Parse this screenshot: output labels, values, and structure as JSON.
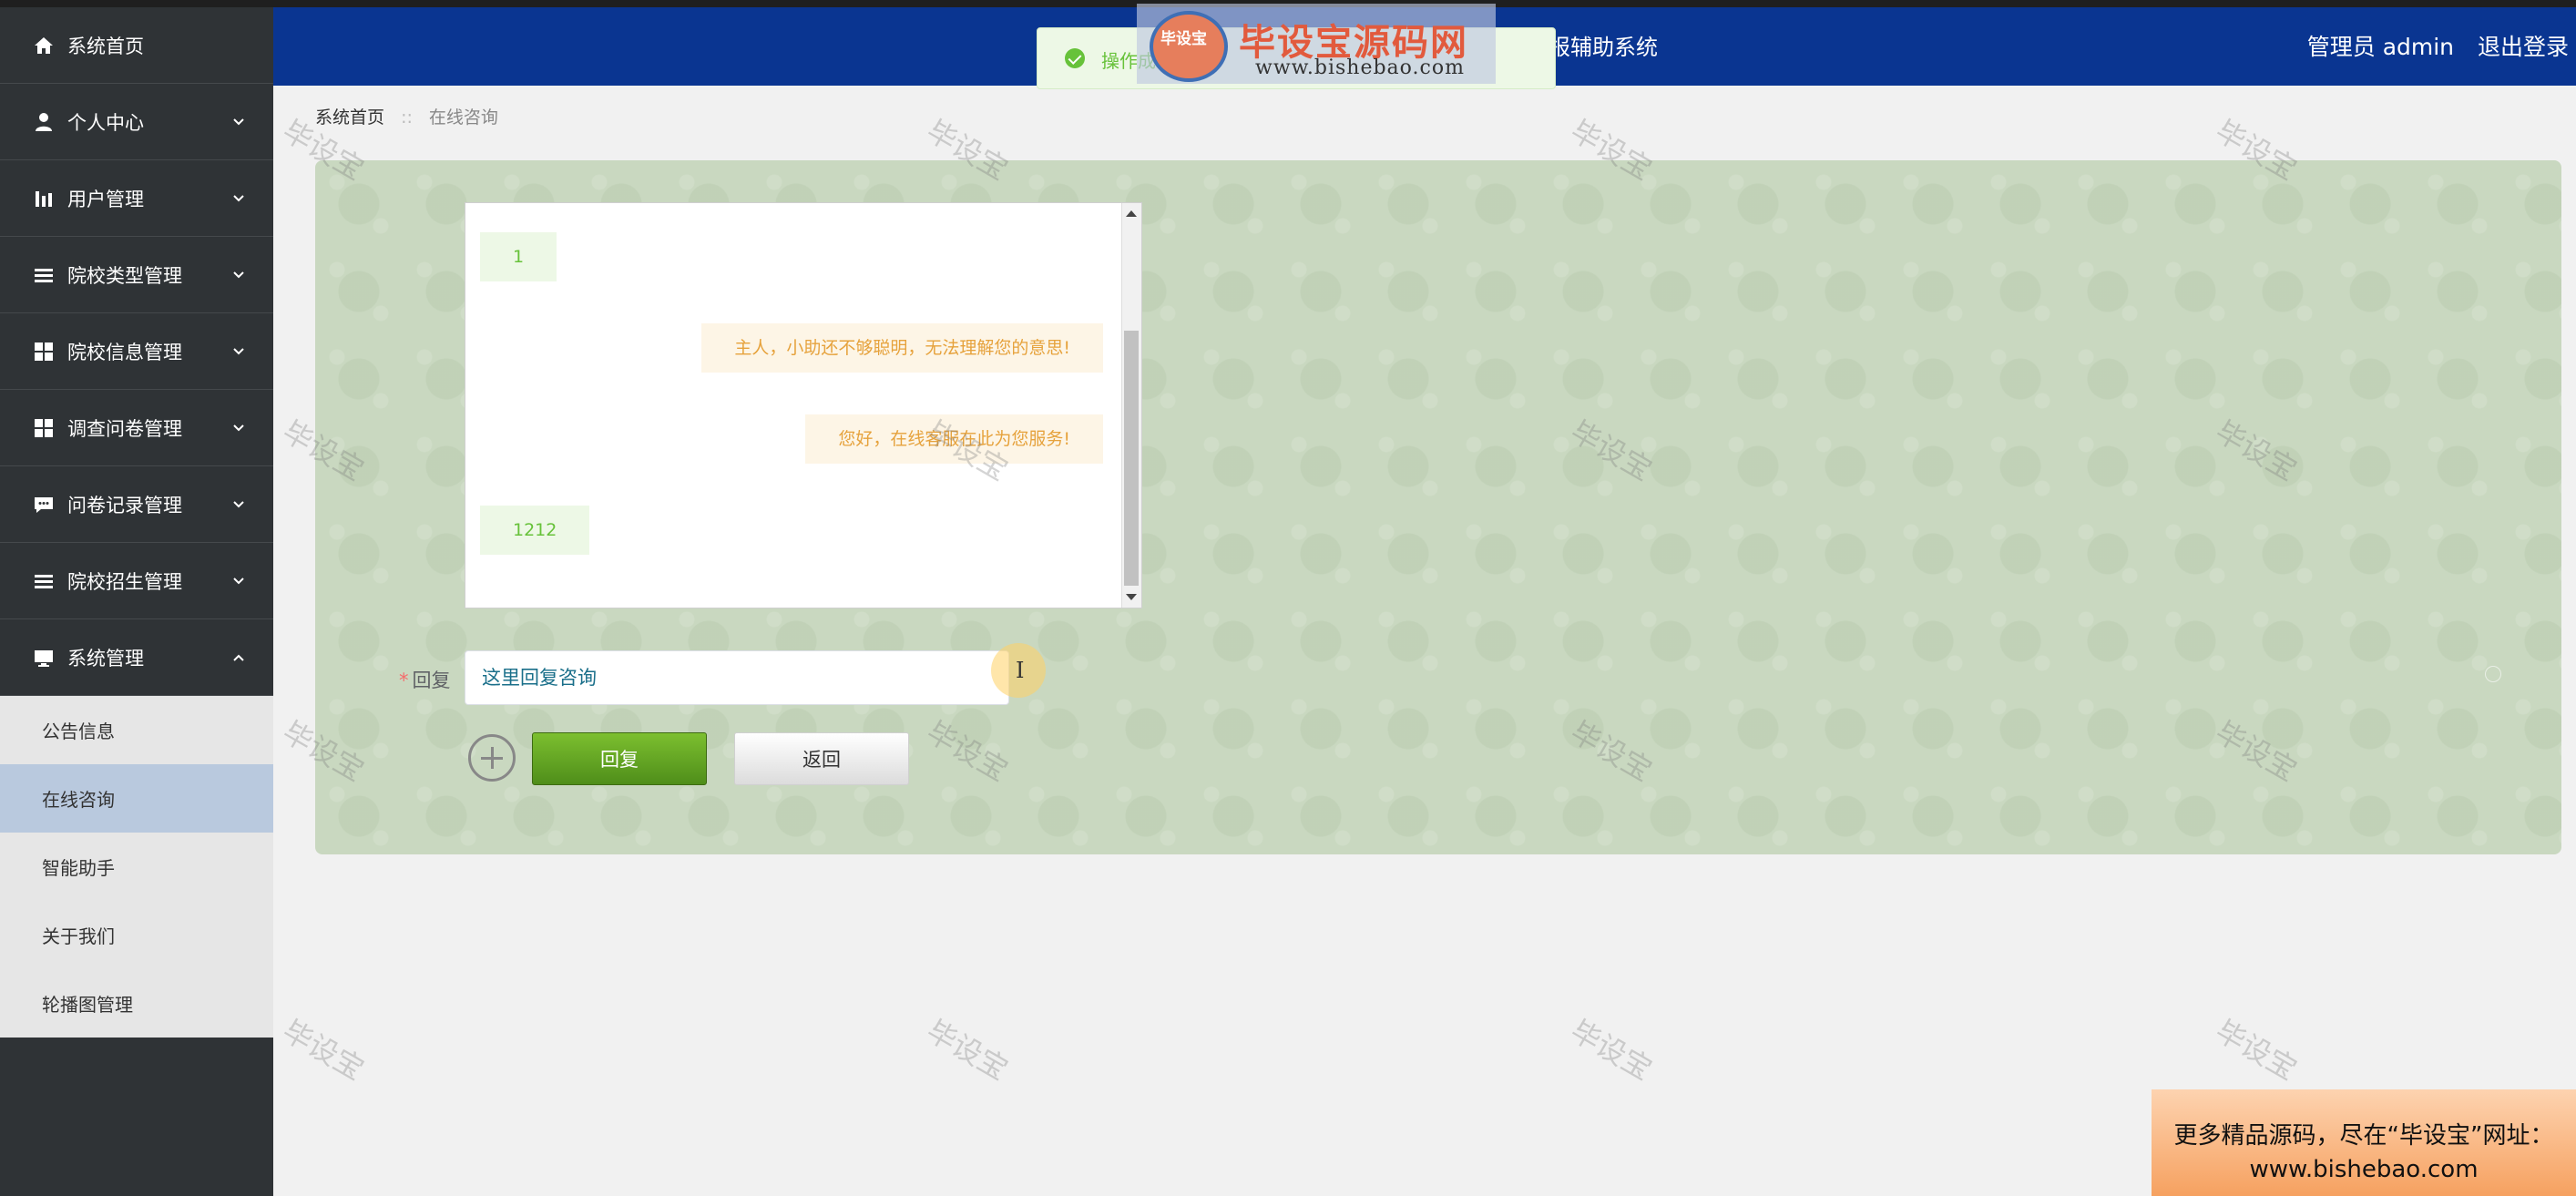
{
  "header": {
    "system_title": "报辅助系统",
    "user_label": "管理员 admin",
    "logout_label": "退出登录"
  },
  "toast": {
    "message": "操作成功"
  },
  "logo": {
    "title": "毕设宝源码网",
    "url": "www.bishebao.com",
    "badge_text": "毕设宝"
  },
  "sidebar": {
    "items": [
      {
        "label": "系统首页",
        "icon": "home-icon",
        "has_arrow": false
      },
      {
        "label": "个人中心",
        "icon": "user-icon",
        "has_arrow": true
      },
      {
        "label": "用户管理",
        "icon": "chart-icon",
        "has_arrow": true
      },
      {
        "label": "院校类型管理",
        "icon": "list-icon",
        "has_arrow": true
      },
      {
        "label": "院校信息管理",
        "icon": "grid-icon",
        "has_arrow": true
      },
      {
        "label": "调查问卷管理",
        "icon": "grid-icon",
        "has_arrow": true
      },
      {
        "label": "问卷记录管理",
        "icon": "comment-icon",
        "has_arrow": true
      },
      {
        "label": "院校招生管理",
        "icon": "list-icon",
        "has_arrow": true
      },
      {
        "label": "系统管理",
        "icon": "monitor-icon",
        "has_arrow": true,
        "expanded": true
      }
    ],
    "submenu": [
      {
        "label": "公告信息",
        "active": false
      },
      {
        "label": "在线咨询",
        "active": true
      },
      {
        "label": "智能助手",
        "active": false
      },
      {
        "label": "关于我们",
        "active": false
      },
      {
        "label": "轮播图管理",
        "active": false
      }
    ]
  },
  "breadcrumb": {
    "home": "系统首页",
    "separator": "::",
    "current": "在线咨询"
  },
  "chat": {
    "messages": [
      {
        "side": "left",
        "text": "1"
      },
      {
        "side": "right",
        "text": "主人，小助还不够聪明，无法理解您的意思!"
      },
      {
        "side": "right",
        "text": "您好，在线客服在此为您服务!"
      },
      {
        "side": "left",
        "text": "1212"
      }
    ]
  },
  "form": {
    "reply_label": "回复",
    "required_mark": "*",
    "reply_placeholder": "这里回复咨询",
    "reply_button": "回复",
    "back_button": "返回"
  },
  "watermark": {
    "text": "毕设宝"
  },
  "ad": {
    "line1": "更多精品源码，尽在“毕设宝”网址：",
    "line2": "www.bishebao.com"
  },
  "colors": {
    "header_bg": "#0a3591",
    "sidebar_bg": "#2f3336",
    "submenu_active": "#b9c9de",
    "reply_button": "#5a9a1f",
    "toast_text": "#67c23a"
  }
}
